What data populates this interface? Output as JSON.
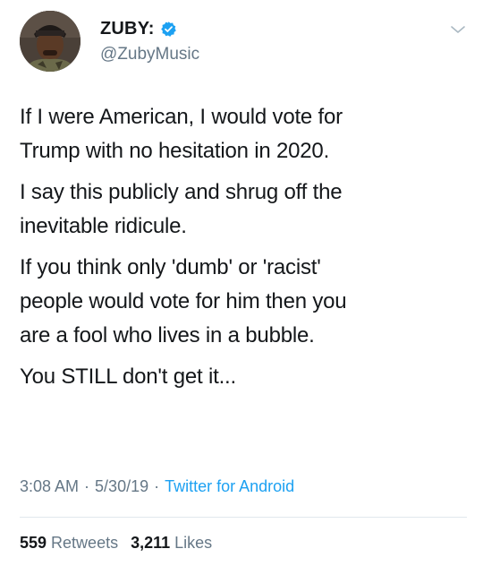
{
  "author": {
    "display_name": "ZUBY:",
    "handle": "@ZubyMusic",
    "verified": true,
    "avatar": "profile-photo"
  },
  "tweet": {
    "paragraphs": [
      "If I were American, I would vote for\nTrump with no hesitation in 2020.",
      "I say this publicly and shrug off the\ninevitable ridicule.",
      "If you think only 'dumb' or 'racist'\npeople would vote for him then you\nare a fool who lives in a bubble.",
      "You STILL don't get it..."
    ],
    "time": "3:08 AM",
    "date": "5/30/19",
    "source": "Twitter for Android",
    "separator": "·"
  },
  "stats": {
    "retweets_count": "559",
    "retweets_label": "Retweets",
    "likes_count": "3,211",
    "likes_label": "Likes"
  },
  "colors": {
    "accent": "#1da1f2",
    "text": "#14171a",
    "secondary": "#657786",
    "divider": "#e1e8ed"
  },
  "icons": {
    "verified": "verified-badge-icon",
    "menu": "chevron-down-icon"
  }
}
